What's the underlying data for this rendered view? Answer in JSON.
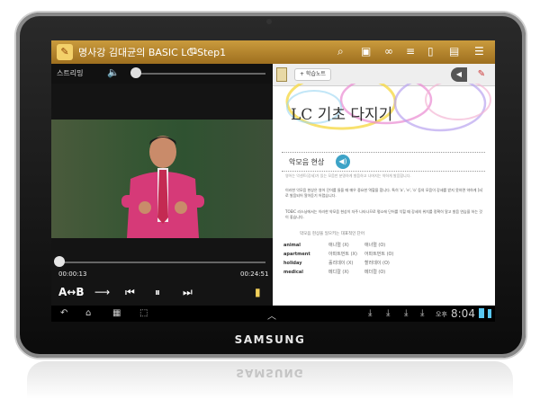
{
  "app": {
    "title": "명사강 김대균의 BASIC LC-Step1"
  },
  "toolbar_icons": [
    "menu-book-icon",
    "search-icon",
    "id-card-icon",
    "link-icon",
    "text-edit-icon",
    "bookmark-icon",
    "notes-icon",
    "settings-list-icon"
  ],
  "player": {
    "streaming_label": "스트리밍",
    "current_time": "00:00:13",
    "total_time": "00:24:51",
    "progress_fraction": 0.01,
    "volume_fraction": 0.0,
    "ab_label": "A↔B"
  },
  "document": {
    "note_button": "+ 학습노트",
    "heading": "LC 기초 다지기",
    "section_label": "악모음 현상",
    "intro": "영어는 악센트(강세)가 있는 모음만 분명하게 발음하고 나머지는 약하게 발음합니다.",
    "para1": "이러한 악모음 현상은 영어 단어를 들을 때 매우 중요한 역할을 합니다. 특히 'a', 'e', 'o' 등의 모음이 강세를 받지 못하면 약하게 [ə]로 발음되어 알아듣기 어렵습니다.",
    "para2": "TOEIC 리스닝에서는 이러한 약모음 현상이 자주 나타나므로 평소에 단어를 익힐 때 강세의 위치를 정확히 알고 발음 연습을 하는 것이 좋습니다.",
    "vocab_title": "악모음 현상을 일으키는 대표적인 단어",
    "vocab": [
      {
        "word": "animal",
        "a": "애니멀 (X)",
        "b": "애너멀 (O)"
      },
      {
        "word": "apartment",
        "a": "아파트먼트 (X)",
        "b": "어파트먼트 (O)"
      },
      {
        "word": "holiday",
        "a": "홀리데이 (X)",
        "b": "할러데이 (O)"
      },
      {
        "word": "medical",
        "a": "메디칼 (X)",
        "b": "메더컬 (O)"
      }
    ]
  },
  "system": {
    "ampm": "오후",
    "clock": "8:04"
  },
  "device": {
    "brand": "SAMSUNG"
  },
  "colors": {
    "titlebar": "#b5852d",
    "accent": "#3da3c7",
    "status": "#59c7f0"
  }
}
